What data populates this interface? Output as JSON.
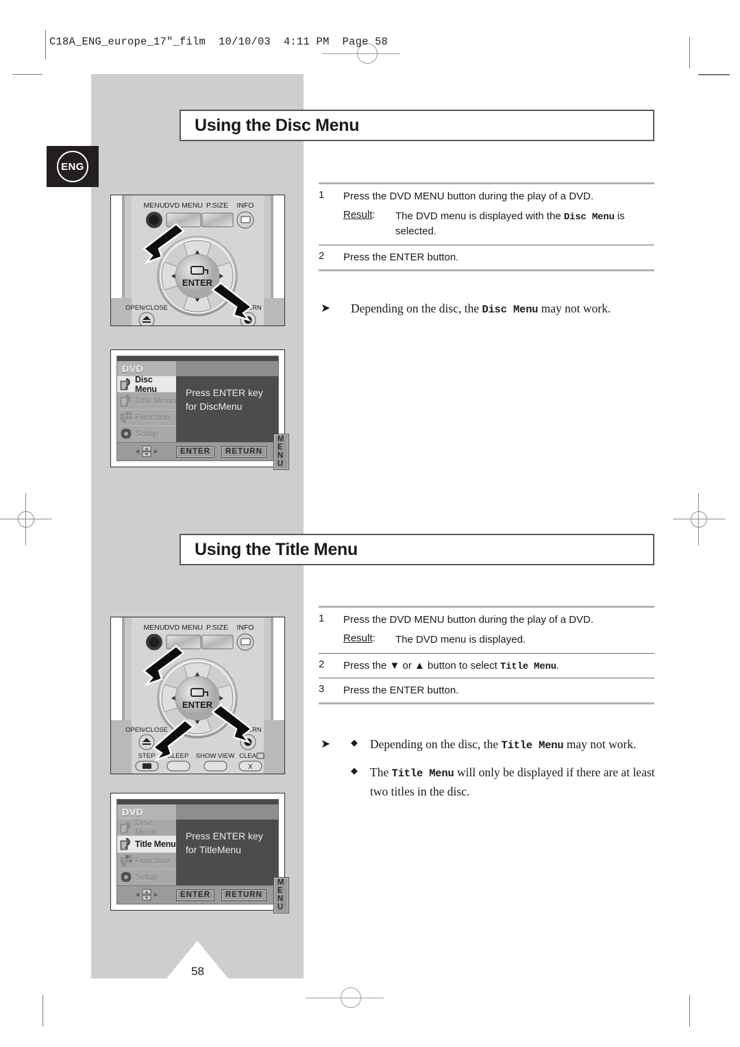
{
  "page": {
    "file_header": "C18A_ENG_europe_17\"_film  10/10/03  4:11 PM  Page 58",
    "language_badge": "ENG",
    "page_number": "58"
  },
  "sections": [
    {
      "title": "Using the Disc Menu",
      "steps": [
        {
          "num": "1",
          "text": "Press the DVD MENU button during the play of a DVD.",
          "result_label": "Result",
          "result_colon": ":",
          "result_pre": "The DVD menu is displayed with the ",
          "result_mono": "Disc Menu",
          "result_post": " is selected."
        },
        {
          "num": "2",
          "text": "Press the ENTER button."
        }
      ],
      "notes": [
        {
          "arrow": "➤",
          "bullet": "",
          "pre": "Depending on the disc, the ",
          "mono": "Disc Menu",
          "post": " may not work."
        }
      ],
      "remote": {
        "top_buttons": [
          "MENU",
          "DVD MENU",
          "P.SIZE",
          "INFO"
        ],
        "enter_label": "ENTER",
        "left_label": "OPEN/CLOSE",
        "right_label": "RETURN",
        "bottom_buttons": []
      },
      "osd": {
        "header": "DVD",
        "items": [
          {
            "label": "Disc Menu",
            "icon": "disc-menu-icon",
            "selected": true
          },
          {
            "label": "Title Menu",
            "icon": "title-menu-icon",
            "selected": false
          },
          {
            "label": "Function",
            "icon": "function-icon",
            "selected": false
          },
          {
            "label": "Setup",
            "icon": "setup-gear-icon",
            "selected": false
          }
        ],
        "body_line1": "Press ENTER key",
        "body_line2": "for DiscMenu",
        "buttons": [
          "ENTER",
          "RETURN",
          "M E N U"
        ]
      }
    },
    {
      "title": "Using the Title Menu",
      "steps": [
        {
          "num": "1",
          "text": "Press the DVD MENU button during the play of a DVD.",
          "result_label": "Result",
          "result_colon": ":",
          "result_pre": "The DVD menu is displayed.",
          "result_mono": "",
          "result_post": ""
        },
        {
          "num": "2",
          "text_pre": "Press the ▼ or ▲ button to select ",
          "text_mono": "Title Menu",
          "text_post": "."
        },
        {
          "num": "3",
          "text": "Press the ENTER button."
        }
      ],
      "notes": [
        {
          "arrow": "➤",
          "bullet": "◆",
          "pre": "Depending on the disc, the ",
          "mono": "Title Menu",
          "post": " may not work."
        },
        {
          "arrow": "",
          "bullet": "◆",
          "pre": "The ",
          "mono": "Title Menu",
          "post": " will only be displayed if there are at least two titles in the disc."
        }
      ],
      "remote": {
        "top_buttons": [
          "MENU",
          "DVD MENU",
          "P.SIZE",
          "INFO"
        ],
        "enter_label": "ENTER",
        "left_label": "OPEN/CLOSE",
        "right_label": "RETURN",
        "bottom_buttons": [
          "STEP",
          "SLEEP",
          "SHOW VIEW",
          "CLEAR"
        ]
      },
      "osd": {
        "header": "DVD",
        "items": [
          {
            "label": "Disc Menu",
            "icon": "disc-menu-icon",
            "selected": false
          },
          {
            "label": "Title Menu",
            "icon": "title-menu-icon",
            "selected": true
          },
          {
            "label": "Function",
            "icon": "function-icon",
            "selected": false
          },
          {
            "label": "Setup",
            "icon": "setup-gear-icon",
            "selected": false
          }
        ],
        "body_line1": "Press ENTER key",
        "body_line2": "for TitleMenu",
        "buttons": [
          "ENTER",
          "RETURN",
          "M E N U"
        ]
      }
    }
  ],
  "colors": {
    "gray_column": "#cecece",
    "heading_border": "#58595b",
    "osd_body": "#4c4c4c",
    "badge": "#231f20"
  }
}
